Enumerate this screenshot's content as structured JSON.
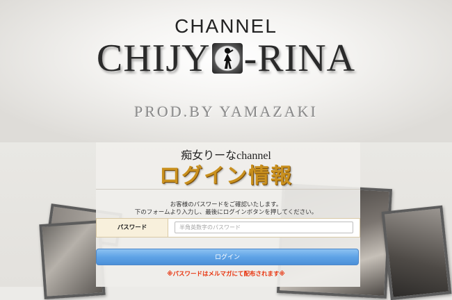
{
  "header": {
    "logo_top": "CHANNEL",
    "logo_left": "CHIJY",
    "logo_right": "-RINA",
    "logo_sub": "PROD.BY YAMAZAKI"
  },
  "login": {
    "site_name": "痴女りーなchannel",
    "heading": "ログイン情報",
    "description_line1": "お客様のパスワードをご確認いたします。",
    "description_line2": "下のフォームより入力し、最後にログインボタンを押してください。",
    "password_label": "パスワード",
    "password_placeholder": "半角英数字のパスワード",
    "password_value": "",
    "button_label": "ログイン",
    "notice": "※パスワードはメルマガにて配布されます※"
  },
  "colors": {
    "heading_gold": "#c9901e",
    "button_blue": "#5fa3e6",
    "notice_red": "#e8320c"
  }
}
